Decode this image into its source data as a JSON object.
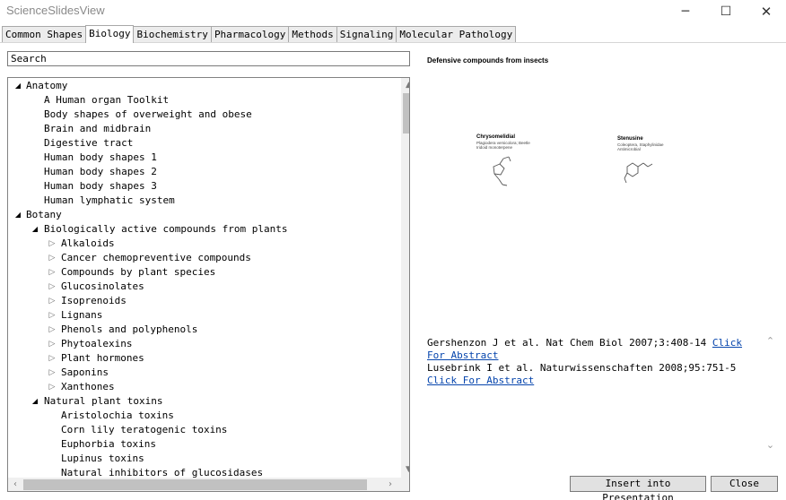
{
  "window": {
    "title": "ScienceSlidesView"
  },
  "tabs": [
    {
      "label": "Common Shapes",
      "active": false
    },
    {
      "label": "Biology",
      "active": true
    },
    {
      "label": "Biochemistry",
      "active": false
    },
    {
      "label": "Pharmacology",
      "active": false
    },
    {
      "label": "Methods",
      "active": false
    },
    {
      "label": "Signaling",
      "active": false
    },
    {
      "label": "Molecular Pathology",
      "active": false
    }
  ],
  "search": {
    "placeholder": "Search",
    "value": ""
  },
  "tree": [
    {
      "label": "Anatomy",
      "level": 0,
      "state": "expanded"
    },
    {
      "label": "A Human organ Toolkit",
      "level": 1,
      "state": "leaf"
    },
    {
      "label": "Body shapes of overweight and obese",
      "level": 1,
      "state": "leaf"
    },
    {
      "label": "Brain and midbrain",
      "level": 1,
      "state": "leaf"
    },
    {
      "label": "Digestive tract",
      "level": 1,
      "state": "leaf"
    },
    {
      "label": "Human body shapes 1",
      "level": 1,
      "state": "leaf"
    },
    {
      "label": "Human body shapes 2",
      "level": 1,
      "state": "leaf"
    },
    {
      "label": "Human body shapes 3",
      "level": 1,
      "state": "leaf"
    },
    {
      "label": "Human lymphatic system",
      "level": 1,
      "state": "leaf"
    },
    {
      "label": "Botany",
      "level": 0,
      "state": "expanded"
    },
    {
      "label": "Biologically active compounds from plants",
      "level": 1,
      "state": "expanded"
    },
    {
      "label": "Alkaloids",
      "level": 2,
      "state": "collapsed"
    },
    {
      "label": "Cancer chemopreventive compounds",
      "level": 2,
      "state": "collapsed"
    },
    {
      "label": "Compounds by plant species",
      "level": 2,
      "state": "collapsed"
    },
    {
      "label": "Glucosinolates",
      "level": 2,
      "state": "collapsed"
    },
    {
      "label": "Isoprenoids",
      "level": 2,
      "state": "collapsed"
    },
    {
      "label": "Lignans",
      "level": 2,
      "state": "collapsed"
    },
    {
      "label": "Phenols and polyphenols",
      "level": 2,
      "state": "collapsed"
    },
    {
      "label": "Phytoalexins",
      "level": 2,
      "state": "collapsed"
    },
    {
      "label": "Plant hormones",
      "level": 2,
      "state": "collapsed"
    },
    {
      "label": "Saponins",
      "level": 2,
      "state": "collapsed"
    },
    {
      "label": "Xanthones",
      "level": 2,
      "state": "collapsed"
    },
    {
      "label": "Natural plant toxins",
      "level": 1,
      "state": "expanded"
    },
    {
      "label": "Aristolochia toxins",
      "level": 2,
      "state": "leaf"
    },
    {
      "label": "Corn lily teratogenic toxins",
      "level": 2,
      "state": "leaf"
    },
    {
      "label": "Euphorbia toxins",
      "level": 2,
      "state": "leaf"
    },
    {
      "label": "Lupinus toxins",
      "level": 2,
      "state": "leaf"
    },
    {
      "label": "Natural inhibitors of glucosidases",
      "level": 2,
      "state": "leaf"
    }
  ],
  "preview": {
    "title": "Defensive compounds from insects",
    "compounds": [
      {
        "name": "Chrysomelidial",
        "subtitle": "Plagiodera versicolora; Beetle\nIridoid monoterpene"
      },
      {
        "name": "Stenusine",
        "subtitle": "Coleoptera, Staphylinidae\nAntimicrobial"
      }
    ]
  },
  "references": [
    {
      "text": "Gershenzon J et al. Nat Chem Biol 2007;3:408-14 ",
      "link": "Click For Abstract"
    },
    {
      "text": "Lusebrink I et al. Naturwissenschaften 2008;95:751-5 ",
      "link": "Click For Abstract"
    }
  ],
  "buttons": {
    "insert": "Insert into Presentation",
    "close": "Close"
  },
  "icons": {
    "minimize": "minimize-icon",
    "maximize": "maximize-icon",
    "close": "close-icon",
    "expanded": "triangle-expanded-icon",
    "collapsed": "triangle-collapsed-icon"
  }
}
